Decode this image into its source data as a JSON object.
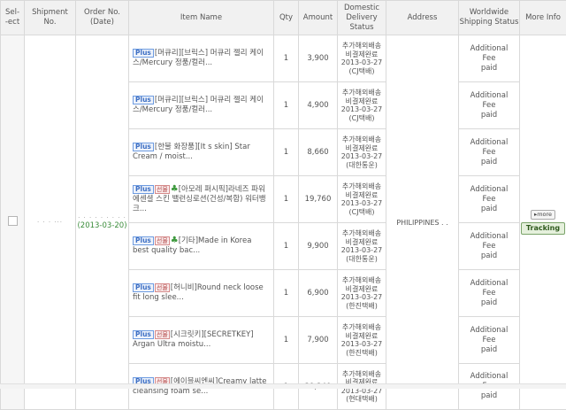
{
  "headers": {
    "select": "Sel-\n-ect",
    "shipment": "Shipment No.",
    "order": "Order No. (Date)",
    "item": "Item Name",
    "qty": "Qty",
    "amount": "Amount",
    "domestic": "Domestic Delivery Status",
    "address": "Address",
    "worldwide": "Worldwide Shipping Status",
    "more": "More Info"
  },
  "order": {
    "shipment_no": "· · ·  ···",
    "order_no": "· · · · · · · · ·",
    "order_date": "(2013-03-20)",
    "address": "PHILIPPINES . .",
    "more_label": "more",
    "tracking_label": "Tracking"
  },
  "rows": [
    {
      "tags": [
        "Plus"
      ],
      "name": "[머큐리][브릭스] 머큐리 젤리 케이스/Mercury 정품/컬러...",
      "qty": "1",
      "amount": "3,900",
      "status": [
        "추가해외배송",
        "비결제완료",
        "2013-03-27",
        "(CJ택배)"
      ],
      "ship": [
        "Additional",
        "Fee",
        "paid"
      ]
    },
    {
      "tags": [
        "Plus"
      ],
      "name": "[머큐리][브릭스] 머큐리 젤리 케이스/Mercury 정품/컬러...",
      "qty": "1",
      "amount": "4,900",
      "status": [
        "추가해외배송",
        "비결제완료",
        "2013-03-27",
        "(CJ택배)"
      ],
      "ship": [
        "Additional",
        "Fee",
        "paid"
      ]
    },
    {
      "tags": [
        "Plus"
      ],
      "name": "[한불 화장품][It s skin] Star Cream / moist...",
      "qty": "1",
      "amount": "8,660",
      "status": [
        "추가해외배송",
        "비결제완료",
        "2013-03-27",
        "(대한통운)"
      ],
      "ship": [
        "Additional",
        "Fee",
        "paid"
      ]
    },
    {
      "tags": [
        "Plus",
        "gift",
        "clover"
      ],
      "name": "[아모레 퍼시픽]라네즈 파워에센셜 스킨 밸런싱로션(건성/복합) 워터뱅크...",
      "qty": "1",
      "amount": "19,760",
      "status": [
        "추가해외배송",
        "비결제완료",
        "2013-03-27",
        "(CJ택배)"
      ],
      "ship": [
        "Additional",
        "Fee",
        "paid"
      ]
    },
    {
      "tags": [
        "Plus",
        "gift",
        "clover"
      ],
      "name": "[기타]Made in Korea best quality bac...",
      "qty": "1",
      "amount": "9,900",
      "status": [
        "추가해외배송",
        "비결제완료",
        "2013-03-27",
        "(대한통운)"
      ],
      "ship": [
        "Additional",
        "Fee",
        "paid"
      ]
    },
    {
      "tags": [
        "Plus",
        "gift"
      ],
      "name": "[허니비]Round neck loose fit long slee...",
      "qty": "1",
      "amount": "6,900",
      "status": [
        "추가해외배송",
        "비결제완료",
        "2013-03-27",
        "(한진택배)"
      ],
      "ship": [
        "Additional",
        "Fee",
        "paid"
      ]
    },
    {
      "tags": [
        "Plus",
        "gift"
      ],
      "name": "[시크릿키][SECRETKEY] Argan Ultra moistu...",
      "qty": "1",
      "amount": "7,900",
      "status": [
        "추가해외배송",
        "비결제완료",
        "2013-03-27",
        "(한진택배)"
      ],
      "ship": [
        "Additional",
        "Fee",
        "paid"
      ]
    },
    {
      "tags": [
        "Plus",
        "gift"
      ],
      "name": "[에이블씨엔씨]Creamy latte cleansing foam se...",
      "qty": "1",
      "amount": "29,240",
      "status": [
        "추가해외배송",
        "비결제완료",
        "2013-03-27",
        "(현대택배)"
      ],
      "ship": [
        "Additional",
        "Fee",
        "paid"
      ]
    }
  ],
  "labels": {
    "plus": "Plus",
    "gift": "선물",
    "clover": "♣"
  }
}
